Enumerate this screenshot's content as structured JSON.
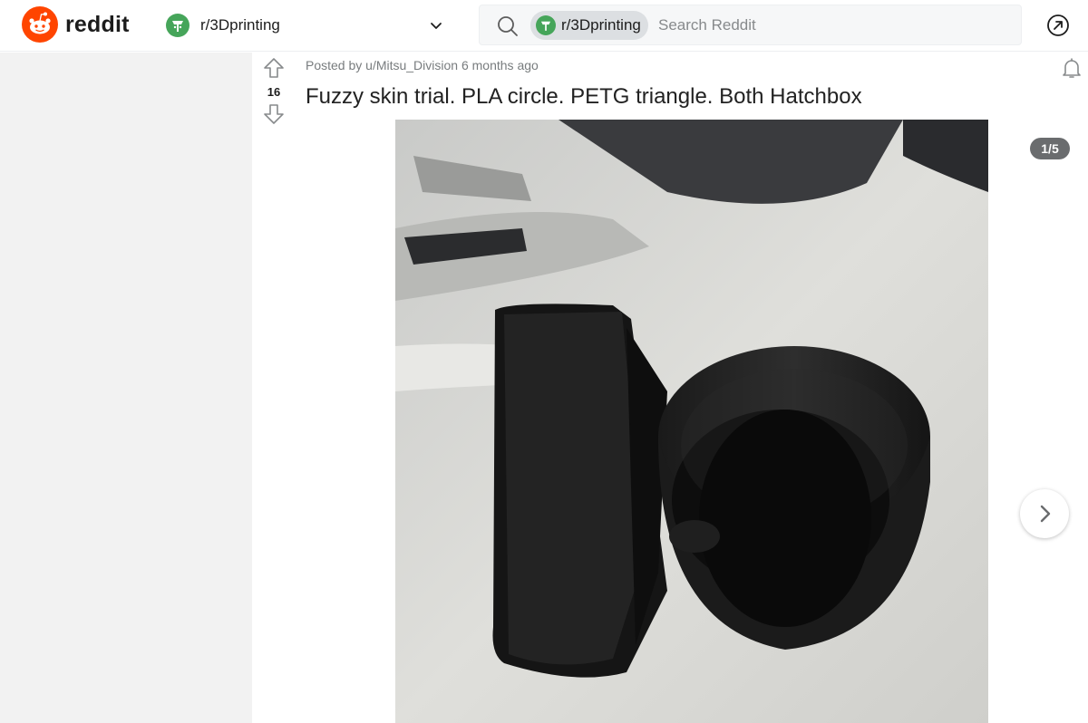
{
  "header": {
    "logo_text": "reddit",
    "community_name": "r/3Dprinting",
    "search_chip": "r/3Dprinting",
    "search_placeholder": "Search Reddit"
  },
  "post": {
    "vote_count": "16",
    "meta": "Posted by u/Mitsu_Division 6 months ago",
    "title": "Fuzzy skin trial. PLA circle. PETG triangle. Both Hatchbox",
    "gallery_counter": "1/5",
    "image_alt": "Black 3D printed fuzzy skin circle and triangle"
  },
  "icons": {
    "logo": "reddit-logo-icon",
    "community": "community-avatar-icon",
    "chevron": "chevron-down-icon",
    "search": "search-icon",
    "open": "open-in-app-icon",
    "upvote": "upvote-arrow-icon",
    "downvote": "downvote-arrow-icon",
    "bell": "notification-bell-icon",
    "next": "chevron-right-icon"
  },
  "colors": {
    "brand": "#ff4500",
    "community_icon": "#46a55a",
    "badge_bg": "#6a6c6e"
  }
}
